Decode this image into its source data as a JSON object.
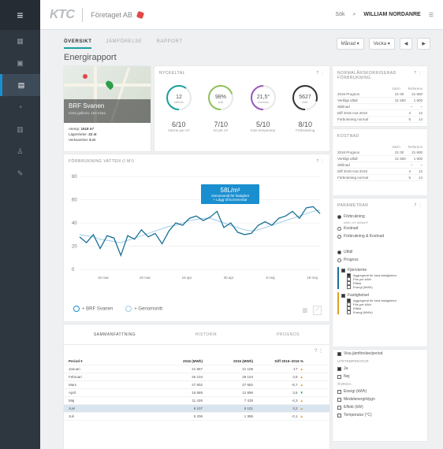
{
  "app": {
    "logo": "KTC",
    "company": "Företaget AB",
    "search_label": "Sök",
    "user": "WILLIAM NORDANRE"
  },
  "sidebar": {
    "items": [
      "dashboard-icon",
      "building-icon",
      "report-icon",
      "analysis-icon",
      "meter-icon",
      "users-icon",
      "tools-icon"
    ]
  },
  "tabs": [
    {
      "label": "ÖVERSIKT",
      "active": true
    },
    {
      "label": "JÄMFÖRELSE",
      "active": false
    },
    {
      "label": "RAPPORT",
      "active": false
    }
  ],
  "controls": {
    "period": "Månad",
    "year": "Vecka",
    "prev": "◀",
    "next": "▶"
  },
  "page_title": "Energirapport",
  "property": {
    "name": "BRF Svanen",
    "address": "Kista galleria, 164 Kista",
    "area_label": "Atemp:",
    "area": "1618 m²",
    "apartments_label": "Lägenheter:",
    "apartments": "22 st",
    "commercial_label": "Verksamhet:",
    "commercial": "5 st"
  },
  "kpi": {
    "title": "NYCKELTAL",
    "gauges": [
      {
        "center": "12",
        "center_sub": "kWh/m²",
        "score": "6/10",
        "label": "Värme per m²",
        "color": "#1aa0a0",
        "fraction": 0.6
      },
      {
        "center": "98%",
        "center_sub": "snitt",
        "score": "7/10",
        "label": "El per m²",
        "color": "#8fc15c",
        "fraction": 0.7
      },
      {
        "center": "21,5°",
        "center_sub": "inomhus",
        "score": "5/10",
        "label": "Inne temperatur",
        "color": "#9b59b6",
        "fraction": 0.5
      },
      {
        "center": "5627",
        "center_sub": "kWh",
        "score": "8/10",
        "label": "Förbrukning",
        "color": "#333333",
        "fraction": 0.8
      }
    ]
  },
  "normal": {
    "title": "NORMALÅRSKORRIGERAD FÖRBRUKNING",
    "cols": [
      "Värm",
      "Referens"
    ],
    "rows": [
      {
        "label": "2016 Prognos",
        "v1": "21 00",
        "v2": "21 600"
      },
      {
        "label": "Verkligt utfall",
        "v1": "21 500",
        "v2": "1 600"
      },
      {
        "label": "Skillnad",
        "v1": "–",
        "v2": "–"
      },
      {
        "label": "Diff 2015 mot 2016",
        "v1": "4",
        "v2": "12"
      },
      {
        "label": "Förbrukning normal",
        "v1": "5",
        "v2": "14"
      }
    ]
  },
  "cost": {
    "title": "KOSTNAD",
    "cols": [
      "Värm",
      "Referens"
    ],
    "rows": [
      {
        "label": "2016 Prognos",
        "v1": "21 00",
        "v2": "21 600"
      },
      {
        "label": "Verkligt utfall",
        "v1": "21 500",
        "v2": "1 600"
      },
      {
        "label": "Skillnad",
        "v1": "–",
        "v2": "–"
      },
      {
        "label": "Diff 2015 mot 2016",
        "v1": "4",
        "v2": "12"
      },
      {
        "label": "Förbrukning normal",
        "v1": "5",
        "v2": "14"
      }
    ]
  },
  "filters": {
    "title": "PARAMETRAR",
    "radio1": [
      {
        "label": "Förbrukning",
        "on": true,
        "sub": "kWh, m³, kWh/m²"
      },
      {
        "label": "Kostnad",
        "on": false,
        "sub": ""
      },
      {
        "label": "Förbrukning & Kostnad",
        "on": false,
        "sub": ""
      }
    ],
    "radio2": [
      {
        "label": "Utfall",
        "on": true
      },
      {
        "label": "Prognos",
        "on": false
      }
    ],
    "tree1": {
      "label": "Fjärrvärme",
      "items": [
        "Aggregerat för hela fastigheten",
        "Pris per kWh",
        "Effekt",
        "Energi (MWh)"
      ]
    },
    "tree2": {
      "label": "Fastighetsel",
      "items": [
        "Aggregerat för hela fastigheten",
        "Pris per kWh",
        "Effekt",
        "Energi (MWh)"
      ]
    },
    "compare_label": "Visa jämförelse/period",
    "temp_title": "UTETEMPERATUR",
    "temp_items": [
      {
        "label": "Ja",
        "on": true
      },
      {
        "label": "Nej",
        "on": false
      }
    ],
    "other_title": "ÖVRIGA",
    "other_items": [
      "Energi (kWh)",
      "Medelenergi/dygn",
      "Effekt (kW)",
      "Temperatur (°C)"
    ]
  },
  "chart_title": "FÖRBRUKNING VATTEN (I M³)",
  "chart_data": {
    "type": "line",
    "x": [
      "16 mar",
      "20 mar",
      "15 apr",
      "30 apr",
      "5 maj",
      "18 maj"
    ],
    "ylim": [
      0,
      80
    ],
    "yticks": [
      0,
      20,
      40,
      60,
      80
    ],
    "series": [
      {
        "name": "BRF Svanen",
        "color": "#1a6f96",
        "values": [
          28,
          23,
          30,
          18,
          29,
          27,
          12,
          29,
          26,
          34,
          28,
          31,
          22,
          33,
          40,
          38,
          44,
          46,
          42,
          45,
          50,
          36,
          40,
          32,
          30,
          31,
          38,
          41,
          38,
          44,
          46,
          50,
          44,
          53,
          54,
          48
        ]
      },
      {
        "name": "Genomsnitt",
        "color": "#9ecde8",
        "values": [
          30,
          29,
          28,
          26,
          25,
          24,
          23,
          25,
          27,
          29,
          31,
          33,
          35,
          37,
          38,
          40,
          42,
          43,
          44,
          44,
          42,
          40,
          38,
          36,
          34,
          33,
          34,
          36,
          38,
          40,
          42,
          44,
          46,
          48,
          50,
          51
        ]
      }
    ],
    "tooltip": {
      "value": "58L/m²",
      "sub": "Genomsnitt för fastighet",
      "link": "+ Lägg till kommentar"
    }
  },
  "table": {
    "tabs": [
      "SAMMANFATTNING",
      "HISTORIK",
      "PROGNOS"
    ],
    "headers": [
      "Period ▾",
      "2016 (MWh)",
      "2015 (MWh)",
      "Diff 2015–2016 %"
    ],
    "rows": [
      {
        "period": "Januari",
        "a": "21 857",
        "b": "21 108",
        "diff": "-17",
        "dir": "up",
        "hl": false
      },
      {
        "period": "Februari",
        "a": "26 104",
        "b": "29 104",
        "diff": "3,8",
        "dir": "up",
        "hl": false
      },
      {
        "period": "Mars",
        "a": "27 802",
        "b": "27 682",
        "diff": "-8,7",
        "dir": "up",
        "hl": false
      },
      {
        "period": "April",
        "a": "16 869",
        "b": "12 896",
        "diff": "3,6",
        "dir": "down",
        "hl": false
      },
      {
        "period": "Maj",
        "a": "11 426",
        "b": "7 428",
        "diff": "-4,3",
        "dir": "up",
        "hl": false
      },
      {
        "period": "Juni",
        "a": "6 107",
        "b": "6 101",
        "diff": "3,2",
        "dir": "up",
        "hl": true
      },
      {
        "period": "Juli",
        "a": "6 206",
        "b": "1 386",
        "diff": "-0,1",
        "dir": "up",
        "hl": false
      }
    ]
  }
}
